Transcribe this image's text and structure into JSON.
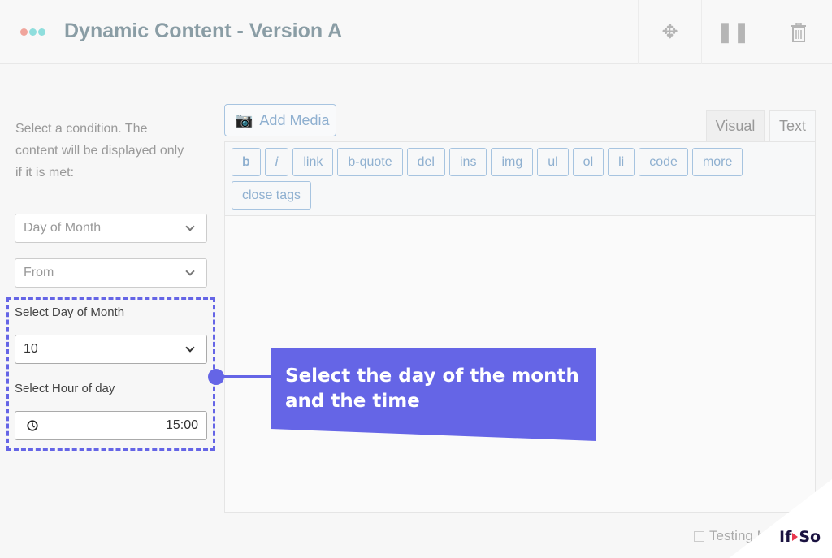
{
  "header": {
    "title": "Dynamic Content - Version A",
    "dot_colors": [
      "#f0a59c",
      "#8fdedd",
      "#8fdedd"
    ],
    "icons": [
      "move-icon",
      "pause-icon",
      "trash-icon"
    ]
  },
  "sidebar": {
    "instruction": "Select a condition. The content will be displayed only if it is met:",
    "condition_select": "Day of Month",
    "operator_select": "From",
    "day_label": "Select Day of Month",
    "day_value": "10",
    "hour_label": "Select Hour of day",
    "hour_value": "15:00"
  },
  "editor": {
    "add_media": "Add Media",
    "tabs": [
      "Visual",
      "Text"
    ],
    "quicktags": [
      "b",
      "i",
      "link",
      "b-quote",
      "del",
      "ins",
      "img",
      "ul",
      "ol",
      "li",
      "code",
      "more",
      "close tags"
    ]
  },
  "callout": {
    "text": "Select the day of the month and the time",
    "color": "#6565e6"
  },
  "footer": {
    "testing_label": "Testing M"
  },
  "logo": {
    "text_left": "If",
    "text_right": "So"
  }
}
